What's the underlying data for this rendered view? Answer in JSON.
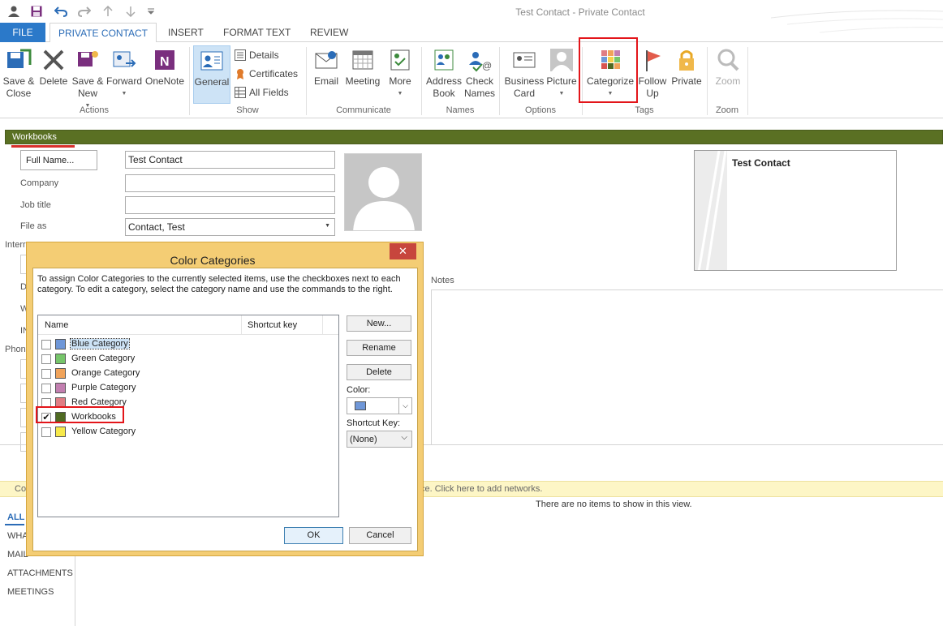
{
  "window": {
    "title": "Test Contact - Private Contact"
  },
  "tabs": [
    {
      "label": "FILE"
    },
    {
      "label": "PRIVATE CONTACT"
    },
    {
      "label": "INSERT"
    },
    {
      "label": "FORMAT TEXT"
    },
    {
      "label": "REVIEW"
    }
  ],
  "ribbon": {
    "actions": {
      "group": "Actions",
      "save_close": "Save &\nClose",
      "delete": "Delete",
      "save_new": "Save &\nNew",
      "forward": "Forward",
      "onenote": "OneNote"
    },
    "show": {
      "group": "Show",
      "general": "General",
      "details": "Details",
      "certificates": "Certificates",
      "all_fields": "All Fields"
    },
    "communicate": {
      "group": "Communicate",
      "email": "Email",
      "meeting": "Meeting",
      "more": "More"
    },
    "names": {
      "group": "Names",
      "address_book": "Address\nBook",
      "check_names": "Check\nNames"
    },
    "options": {
      "group": "Options",
      "business_card": "Business\nCard",
      "picture": "Picture"
    },
    "tags": {
      "group": "Tags",
      "categorize": "Categorize",
      "follow_up": "Follow\nUp",
      "private": "Private"
    },
    "zoom": {
      "group": "Zoom",
      "zoom": "Zoom"
    }
  },
  "category_bar": {
    "label": "Workbooks",
    "color": "#5a7023"
  },
  "form": {
    "full_name_button": "Full Name...",
    "full_name_value": "Test Contact",
    "company_label": "Company",
    "company_value": "",
    "job_title_label": "Job title",
    "job_title_value": "",
    "file_as_label": "File as",
    "file_as_value": "Contact, Test",
    "internet_label": "Interr",
    "phone_label": "Phon",
    "notes_label": "Notes",
    "partial_labels": [
      "D",
      "W",
      "IN"
    ]
  },
  "business_card": {
    "name": "Test Contact"
  },
  "people_pane": {
    "infobar_text": "ce. Click here to add networks.",
    "infobar_prefix": "Co",
    "empty_text": "There are no items to show in this view.",
    "nav": [
      "ALL",
      "WHA",
      "MAIL",
      "ATTACHMENTS",
      "MEETINGS"
    ]
  },
  "dialog": {
    "title": "Color Categories",
    "close": "✕",
    "instructions": "To assign Color Categories to the currently selected items, use the checkboxes next to each category.  To edit a category, select the category name and use the commands to the right.",
    "col_name": "Name",
    "col_shortcut": "Shortcut key",
    "categories": [
      {
        "name": "Blue Category",
        "color": "#6f97d8",
        "checked": false
      },
      {
        "name": "Green Category",
        "color": "#76c56a",
        "checked": false
      },
      {
        "name": "Orange Category",
        "color": "#f0a35a",
        "checked": false
      },
      {
        "name": "Purple Category",
        "color": "#c27fb0",
        "checked": false
      },
      {
        "name": "Red Category",
        "color": "#e07d84",
        "checked": false
      },
      {
        "name": "Workbooks",
        "color": "#4f6a22",
        "checked": true
      },
      {
        "name": "Yellow Category",
        "color": "#f7e94a",
        "checked": false
      }
    ],
    "btn_new": "New...",
    "btn_rename": "Rename",
    "btn_delete": "Delete",
    "color_label": "Color:",
    "color_value": "#6f97d8",
    "shortcut_label": "Shortcut Key:",
    "shortcut_value": "(None)",
    "ok": "OK",
    "cancel": "Cancel"
  }
}
